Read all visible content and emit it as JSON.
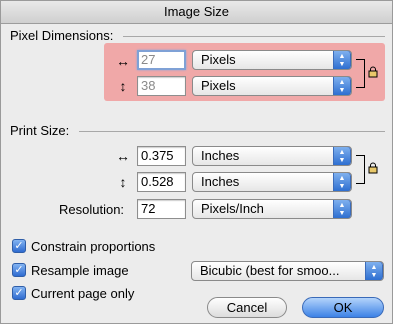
{
  "window": {
    "title": "Image Size"
  },
  "pixel_dimensions": {
    "section_label": "Pixel Dimensions:",
    "width": {
      "icon": "horizontal-arrows-icon",
      "value": "27",
      "unit": "Pixels"
    },
    "height": {
      "icon": "vertical-arrows-icon",
      "value": "38",
      "unit": "Pixels"
    },
    "highlight_color": "#f0a8a8"
  },
  "print_size": {
    "section_label": "Print Size:",
    "width": {
      "icon": "horizontal-arrows-icon",
      "value": "0.375",
      "unit": "Inches"
    },
    "height": {
      "icon": "vertical-arrows-icon",
      "value": "0.528",
      "unit": "Inches"
    },
    "resolution": {
      "label": "Resolution:",
      "value": "72",
      "unit": "Pixels/Inch"
    }
  },
  "options": {
    "constrain_proportions": {
      "label": "Constrain proportions",
      "checked": true
    },
    "resample_image": {
      "label": "Resample image",
      "checked": true,
      "method": "Bicubic (best for smoo..."
    },
    "current_page_only": {
      "label": "Current page only",
      "checked": true
    }
  },
  "buttons": {
    "cancel": "Cancel",
    "ok": "OK"
  }
}
